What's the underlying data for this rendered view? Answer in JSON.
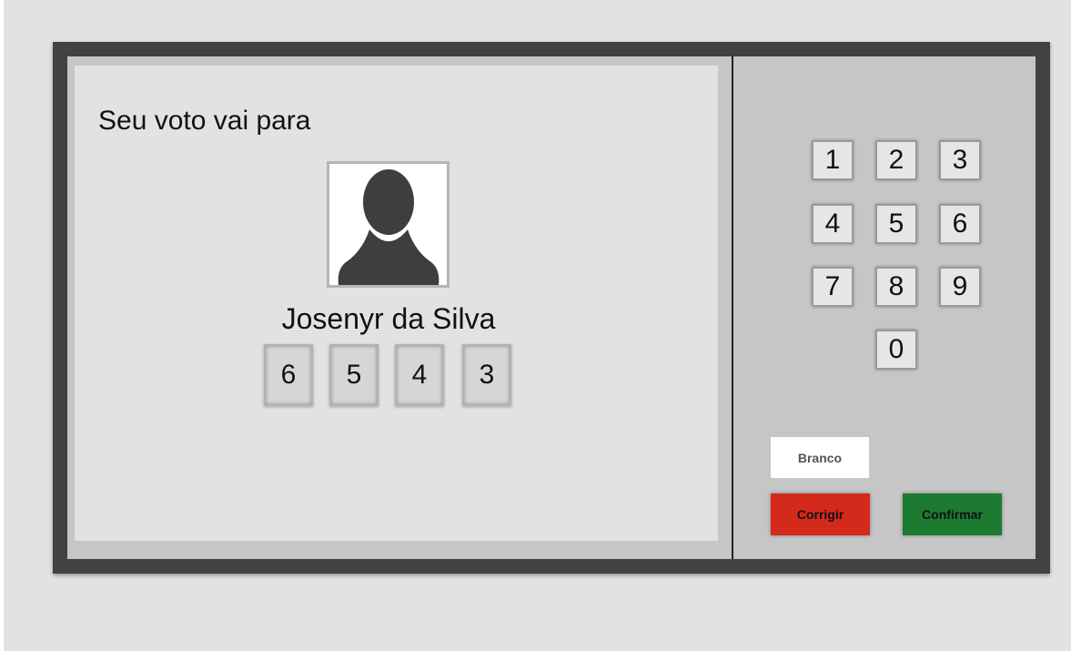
{
  "screen": {
    "prompt": "Seu voto vai para",
    "candidate_name": "Josenyr da Silva",
    "candidate_number_digits": [
      "6",
      "5",
      "4",
      "3"
    ],
    "photo_icon": "person-silhouette-icon"
  },
  "keypad": {
    "keys": [
      "1",
      "2",
      "3",
      "4",
      "5",
      "6",
      "7",
      "8",
      "9",
      "0"
    ]
  },
  "actions": {
    "branco_label": "Branco",
    "corrigir_label": "Corrigir",
    "confirmar_label": "Confirmar"
  },
  "colors": {
    "machine_frame": "#424242",
    "corrigir": "#d42a1c",
    "confirmar": "#1d7a31",
    "branco": "#ffffff"
  }
}
